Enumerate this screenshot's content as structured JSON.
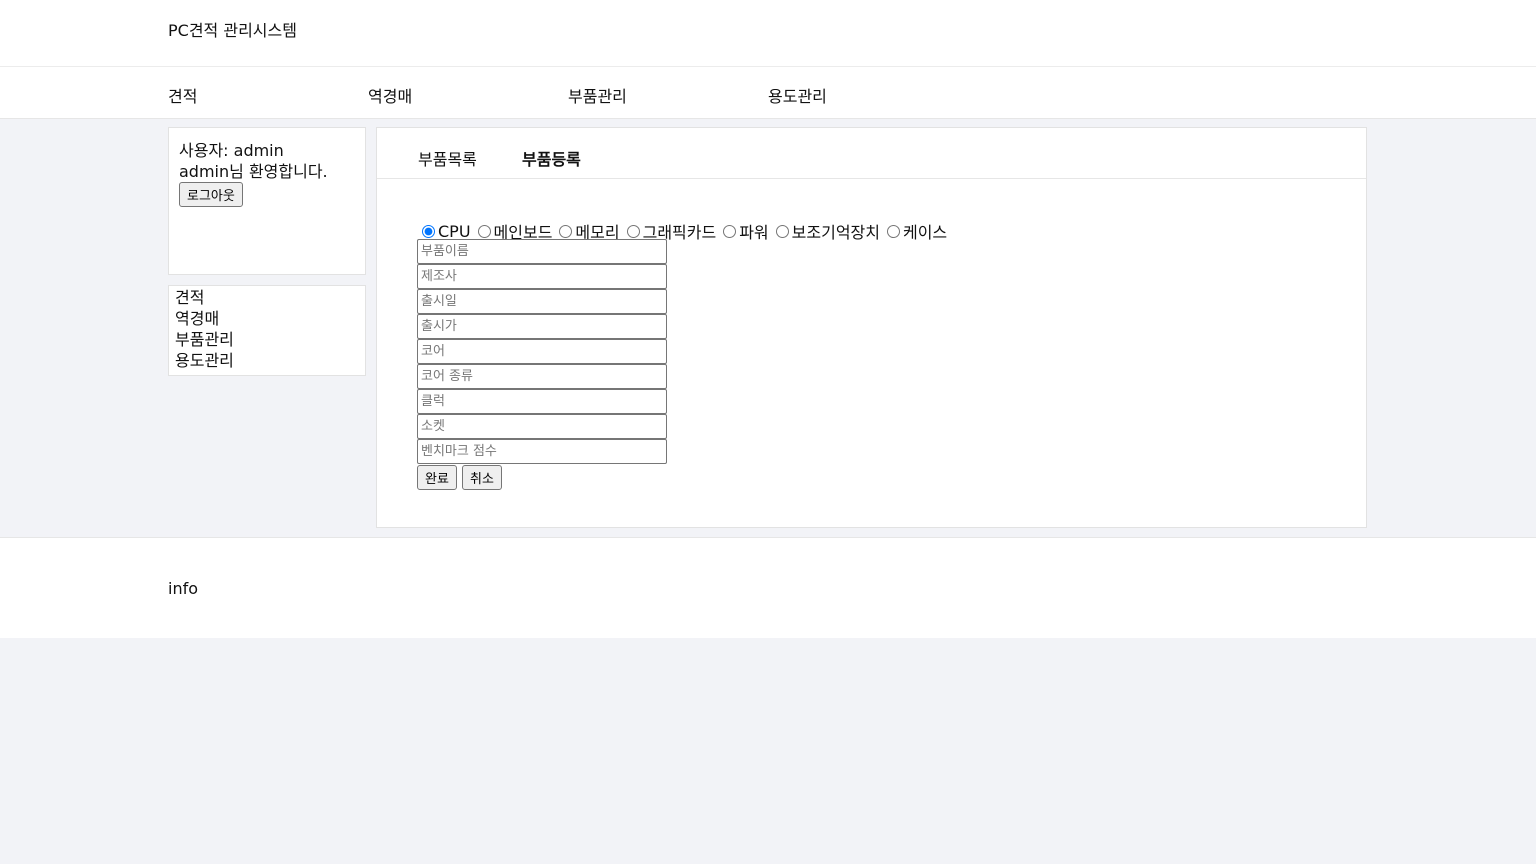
{
  "app": {
    "title": "PC견적 관리시스템"
  },
  "topnav": {
    "items": [
      {
        "label": "견적"
      },
      {
        "label": "역경매"
      },
      {
        "label": "부품관리"
      },
      {
        "label": "용도관리"
      }
    ]
  },
  "user": {
    "line": "사용자: admin",
    "welcome": "admin님 환영합니다.",
    "logout_label": "로그아웃"
  },
  "sidebar": {
    "items": [
      {
        "label": "견적"
      },
      {
        "label": "역경매"
      },
      {
        "label": "부품관리"
      },
      {
        "label": "용도관리"
      }
    ]
  },
  "tabs": [
    {
      "label": "부품목록",
      "active": false
    },
    {
      "label": "부품등록",
      "active": true
    }
  ],
  "part_types": {
    "selected": "CPU",
    "options": [
      {
        "label": "CPU"
      },
      {
        "label": "메인보드"
      },
      {
        "label": "메모리"
      },
      {
        "label": "그래픽카드"
      },
      {
        "label": "파워"
      },
      {
        "label": "보조기억장치"
      },
      {
        "label": "케이스"
      }
    ]
  },
  "form": {
    "fields": [
      {
        "placeholder": "부품이름",
        "value": ""
      },
      {
        "placeholder": "제조사",
        "value": ""
      },
      {
        "placeholder": "출시일",
        "value": ""
      },
      {
        "placeholder": "출시가",
        "value": ""
      },
      {
        "placeholder": "코어",
        "value": ""
      },
      {
        "placeholder": "코어 종류",
        "value": ""
      },
      {
        "placeholder": "클럭",
        "value": ""
      },
      {
        "placeholder": "소켓",
        "value": ""
      },
      {
        "placeholder": "벤치마크 점수",
        "value": ""
      }
    ],
    "submit_label": "완료",
    "cancel_label": "취소"
  },
  "footer": {
    "text": "info"
  }
}
